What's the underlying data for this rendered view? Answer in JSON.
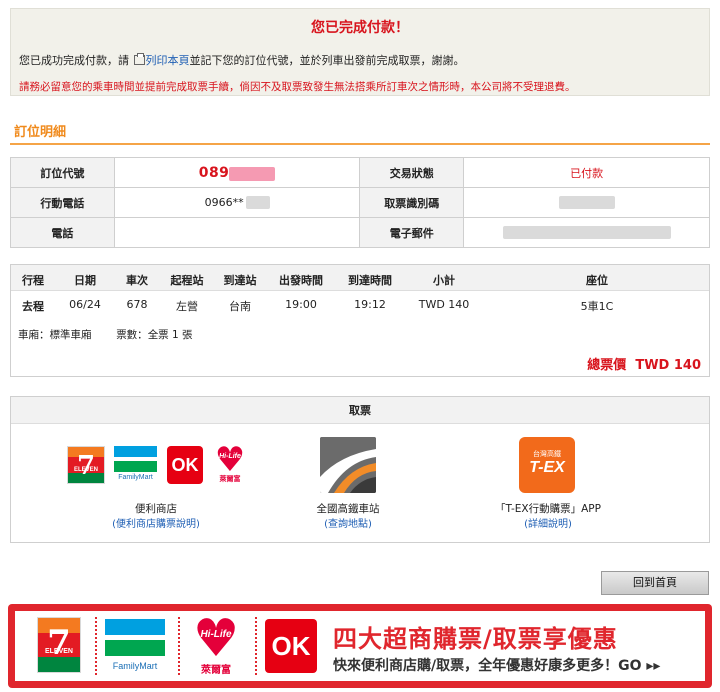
{
  "notice": {
    "title": "您已完成付款！",
    "line1_prefix": "您已成功完成付款，請 ",
    "print_link": "列印本頁",
    "line1_suffix": "並記下您的訂位代號，並於列車出發前完成取票，謝謝。",
    "warning": "請務必留意您的乘車時間並提前完成取票手續，倘因不及取票致發生無法搭乘所訂車次之情形時，本公司將不受理退費。"
  },
  "section_title": "訂位明細",
  "booking": {
    "pnr_label": "訂位代號",
    "pnr_value": "089",
    "status_label": "交易狀態",
    "status_value": "已付款",
    "mobile_label": "行動電話",
    "mobile_value": "0966**",
    "pickup_code_label": "取票識別碼",
    "phone_label": "電話",
    "email_label": "電子郵件"
  },
  "trip": {
    "headers": [
      "行程",
      "日期",
      "車次",
      "起程站",
      "到達站",
      "出發時間",
      "到達時間",
      "小計",
      "座位"
    ],
    "row": [
      "去程",
      "06/24",
      "678",
      "左營",
      "台南",
      "19:00",
      "19:12",
      "TWD 140",
      "5車1C"
    ],
    "car_type_label": "車廂：",
    "car_type_value": "標準車廂",
    "tickets_label": "票數：",
    "tickets_value": "全票 1 張",
    "total_label": "總票價",
    "total_value": "TWD 140"
  },
  "pickup": {
    "title": "取票",
    "options": [
      {
        "name": "便利商店",
        "link": "(便利商店購票說明)"
      },
      {
        "name": "全國高鐵車站",
        "link": "(查詢地點)"
      },
      {
        "name": "「T-EX行動購票」APP",
        "link": "(詳細說明)"
      }
    ]
  },
  "logos": {
    "seven_eleven_text": "ELEVEN",
    "familymart_text": "FamilyMart",
    "ok_text": "OK",
    "hilife_text": "Hi-Life",
    "hilife_sub": "萊爾富",
    "tex_small": "台灣高鐵",
    "tex_text": "T-EX"
  },
  "home_button": "回到首頁",
  "banner": {
    "title": "四大超商購票/取票享優惠",
    "subtitle": "快來便利商店購/取票，全年優惠好康多更多！GO ▸▸"
  },
  "colors": {
    "accent_red": "#d8141d",
    "section_orange": "#f08a1c",
    "link_blue": "#1f5fb4"
  }
}
